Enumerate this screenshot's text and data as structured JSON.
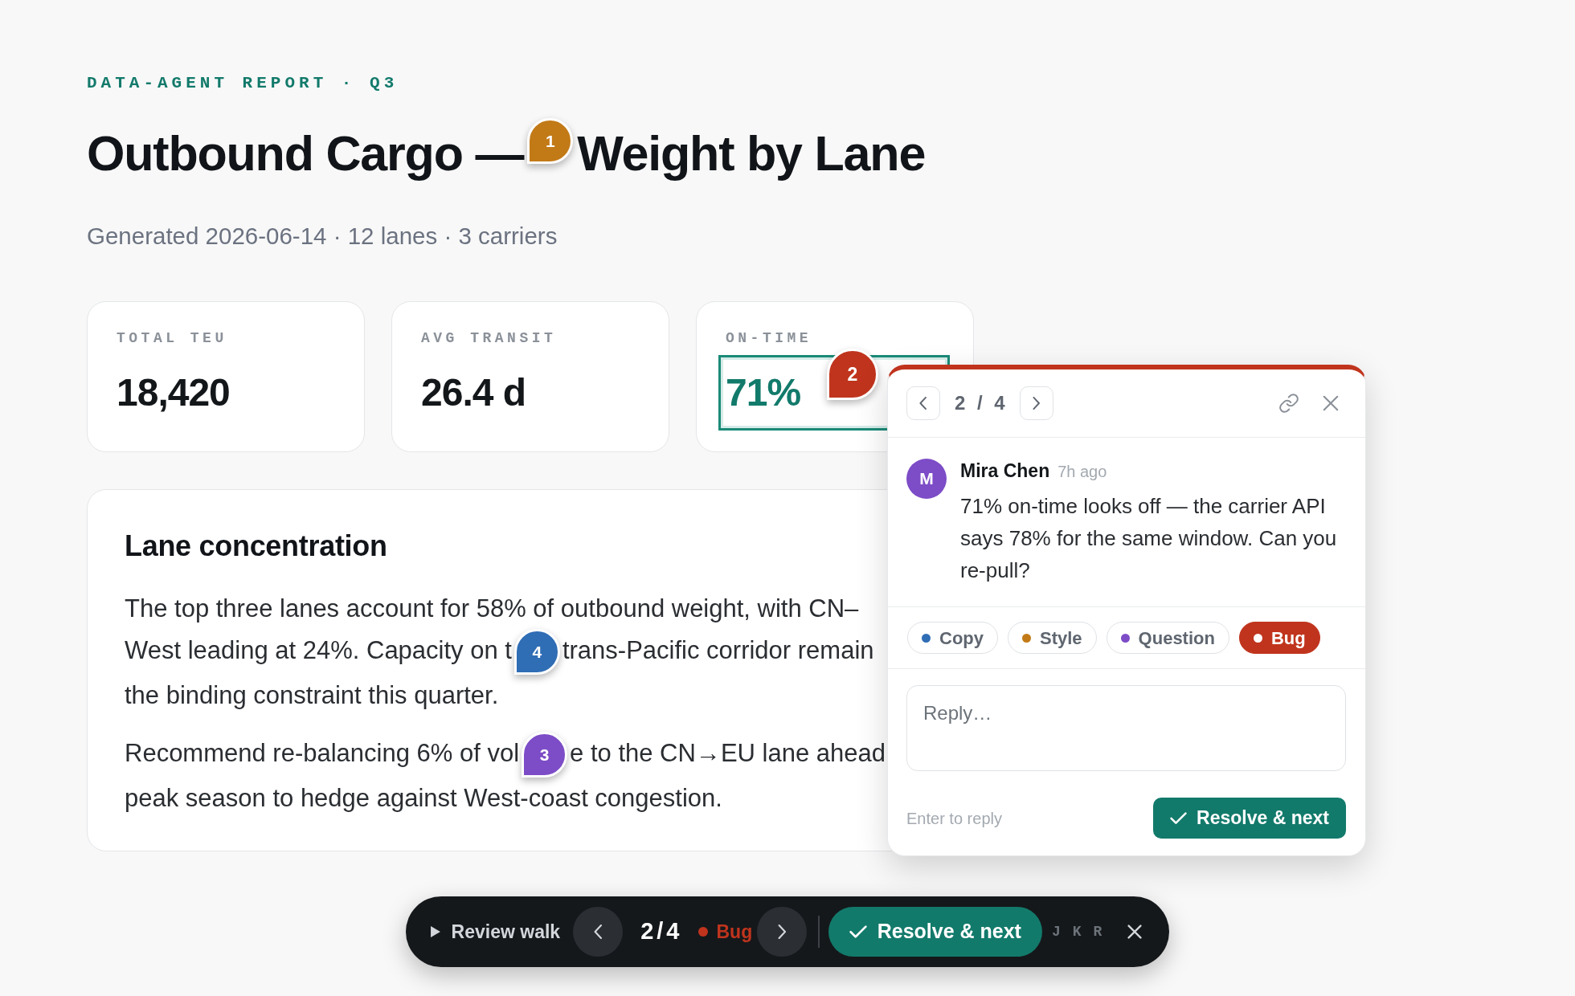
{
  "report": {
    "eyebrow": "DATA-AGENT REPORT · Q3",
    "title": [
      {
        "kind": "text",
        "text": "Outbound Cargo —"
      },
      {
        "kind": "pin",
        "number": "1",
        "color": "#c27a17",
        "selected": false
      },
      {
        "kind": "text",
        "text": "Weight by Lane"
      }
    ],
    "meta": "Generated 2026-06-14 · 12 lanes · 3 carriers"
  },
  "stats": [
    {
      "label": "TOTAL TEU",
      "value": "18,420",
      "highlighted": false
    },
    {
      "label": "AVG TRANSIT",
      "value": "26.4 d",
      "highlighted": false
    },
    {
      "label": "ON-TIME",
      "value": "71%",
      "highlighted": true,
      "pin": {
        "number": "2",
        "color": "#c0341d",
        "selected": true
      }
    }
  ],
  "section": {
    "title": "Lane concentration",
    "paragraphs": [
      {
        "lines": [
          [
            {
              "kind": "text",
              "text": "The top three lanes account for 58% of outbound weight, with CN–"
            }
          ],
          [
            {
              "kind": "text",
              "text": "West leading at 24%. Capacity on t"
            },
            {
              "kind": "pin",
              "number": "4",
              "color": "#2f6db5",
              "selected": false
            },
            {
              "kind": "text",
              "text": "trans-Pacific corridor remain"
            }
          ],
          [
            {
              "kind": "text",
              "text": "the binding constraint this quarter."
            }
          ]
        ]
      },
      {
        "lines": [
          [
            {
              "kind": "text",
              "text": "Recommend re-balancing 6% of vol"
            },
            {
              "kind": "pin",
              "number": "3",
              "color": "#7d4cc7",
              "selected": false
            },
            {
              "kind": "text",
              "text": "e to the CN→EU lane ahead"
            }
          ],
          [
            {
              "kind": "text",
              "text": "peak season to hedge against West-coast congestion."
            }
          ]
        ]
      }
    ]
  },
  "comment_popover": {
    "counter": "2 / 4",
    "author": {
      "initial": "M",
      "name": "Mira Chen",
      "time": "7h ago"
    },
    "text": "71% on-time looks off — the carrier API says 78% for the same window. Can you re-pull?",
    "tags": [
      {
        "label": "Copy",
        "color": "#2f6db5",
        "selected": false
      },
      {
        "label": "Style",
        "color": "#c27a17",
        "selected": false
      },
      {
        "label": "Question",
        "color": "#7d4cc7",
        "selected": false
      },
      {
        "label": "Bug",
        "color": "#c0341d",
        "selected": true
      }
    ],
    "reply": {
      "placeholder": "Reply…"
    },
    "hint": "Enter to reply",
    "resolve_button": "Resolve & next"
  },
  "review_bar": {
    "label": "Review walk",
    "counter": "2/4",
    "category": "Bug",
    "resolve_button": "Resolve & next",
    "shortcuts": [
      "J",
      "K",
      "R"
    ]
  }
}
